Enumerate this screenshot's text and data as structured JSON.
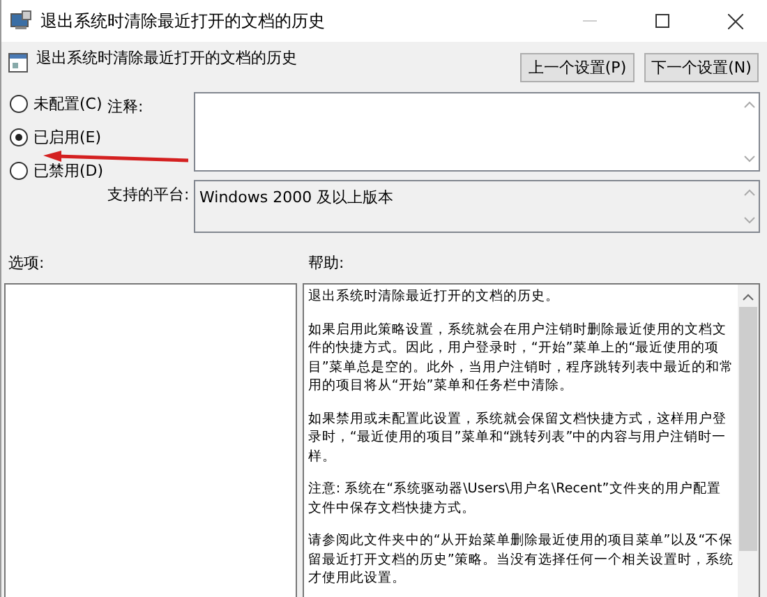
{
  "window": {
    "title": "退出系统时清除最近打开的文档的历史"
  },
  "header": {
    "title": "退出系统时清除最近打开的文档的历史",
    "buttons": [
      "上一个设置(P)",
      "下一个设置(N)"
    ]
  },
  "radios": [
    {
      "label": "未配置(C)",
      "selected": false
    },
    {
      "label": "已启用(E)",
      "selected": true
    },
    {
      "label": "已禁用(D)",
      "selected": false
    }
  ],
  "comment": {
    "label": "注释:"
  },
  "platform": {
    "label": "支持的平台:",
    "value": "Windows 2000 及以上版本"
  },
  "options": {
    "label": "选项:"
  },
  "help": {
    "label": "帮助:",
    "paragraphs": [
      "退出系统时清除最近打开的文档的历史。",
      "如果启用此策略设置，系统就会在用户注销时删除最近使用的文档文件的快捷方式。因此，用户登录时，“开始”菜单上的“最近使用的项目”菜单总是空的。此外，当用户注销时，程序跳转列表中最近的和常用的项目将从“开始”菜单和任务栏中清除。",
      "如果禁用或未配置此设置，系统就会保留文档快捷方式，这样用户登录时，“最近使用的项目”菜单和“跳转列表”中的内容与用户注销时一样。",
      "注意: 系统在“系统驱动器\\Users\\用户名\\Recent”文件夹的用户配置文件中保存文档快捷方式。",
      "请参阅此文件夹中的“从开始菜单删除最近使用的项目菜单”以及“不保留最近打开文档的历史”策略。当没有选择任何一个相关设置时，系统才使用此设置。"
    ]
  }
}
